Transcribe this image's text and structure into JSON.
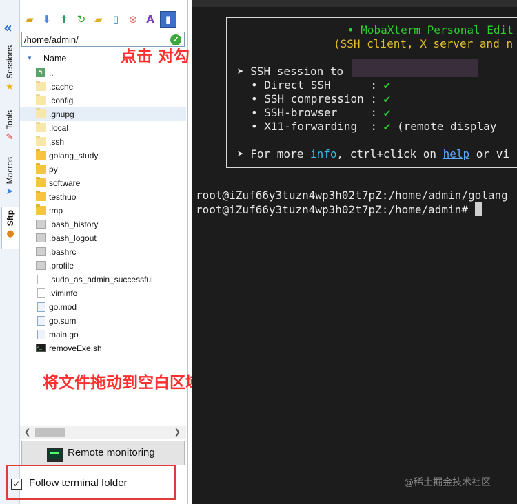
{
  "sidebar_tabs": [
    {
      "label": "Sessions",
      "icon": "star-icon"
    },
    {
      "label": "Tools",
      "icon": "tools-icon"
    },
    {
      "label": "Macros",
      "icon": "paper-plane-icon"
    },
    {
      "label": "Sftp",
      "icon": "sftp-icon"
    }
  ],
  "toolbar_icons": [
    "folder-up-icon",
    "download-icon",
    "upload-icon",
    "refresh-icon",
    "new-folder-icon",
    "new-file-icon",
    "delete-icon",
    "text-icon",
    "permissions-icon"
  ],
  "path": "/home/admin/",
  "column_name": "Name",
  "files": [
    {
      "name": "..",
      "type": "up"
    },
    {
      "name": ".cache",
      "type": "hidden-folder"
    },
    {
      "name": ".config",
      "type": "hidden-folder"
    },
    {
      "name": ".gnupg",
      "type": "hidden-folder"
    },
    {
      "name": ".local",
      "type": "hidden-folder"
    },
    {
      "name": ".ssh",
      "type": "hidden-folder"
    },
    {
      "name": "golang_study",
      "type": "folder"
    },
    {
      "name": "py",
      "type": "folder"
    },
    {
      "name": "software",
      "type": "folder"
    },
    {
      "name": "testhuo",
      "type": "folder"
    },
    {
      "name": "tmp",
      "type": "folder"
    },
    {
      "name": ".bash_history",
      "type": "file-gray"
    },
    {
      "name": ".bash_logout",
      "type": "file-gray"
    },
    {
      "name": ".bashrc",
      "type": "file-gray"
    },
    {
      "name": ".profile",
      "type": "file-gray"
    },
    {
      "name": ".sudo_as_admin_successful",
      "type": "file-white"
    },
    {
      "name": ".viminfo",
      "type": "file-white"
    },
    {
      "name": "go.mod",
      "type": "file-go"
    },
    {
      "name": "go.sum",
      "type": "file-go"
    },
    {
      "name": "main.go",
      "type": "file-go"
    },
    {
      "name": "removeExe.sh",
      "type": "file-sh"
    }
  ],
  "remote_monitoring": "Remote monitoring",
  "follow_terminal": "Follow terminal folder",
  "annotations": {
    "click_check": "点击 对勾",
    "drag_files": "将文件拖动到空白区域"
  },
  "terminal": {
    "banner_title": "• MobaXterm Personal Edit",
    "banner_subtitle": "(SSH client, X server and n",
    "ssh_session": "➤ SSH session to",
    "features": [
      {
        "label": "• Direct SSH      :",
        "check": "✔",
        "extra": ""
      },
      {
        "label": "• SSH compression :",
        "check": "✔",
        "extra": ""
      },
      {
        "label": "• SSH-browser     :",
        "check": "✔",
        "extra": ""
      },
      {
        "label": "• X11-forwarding  :",
        "check": "✔",
        "extra": " (remote display"
      }
    ],
    "more_info_prefix": "➤ For more ",
    "info_word": "info",
    "more_info_mid": ", ctrl+click on ",
    "help_word": "help",
    "more_info_suffix": " or vi",
    "prompt1": "root@iZuf66y3tuzn4wp3h02t7pZ:/home/admin/golang",
    "prompt2": "root@iZuf66y3tuzn4wp3h02t7pZ:/home/admin# "
  },
  "watermark": "@稀土掘金技术社区"
}
